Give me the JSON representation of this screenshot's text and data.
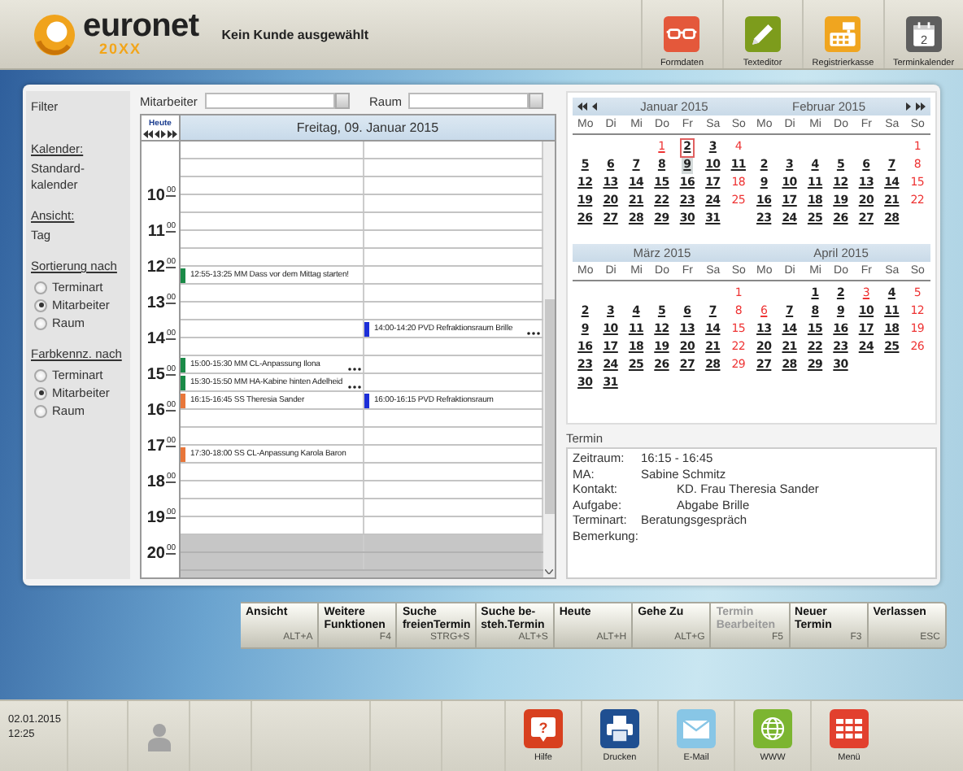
{
  "header": {
    "logo_name": "euronet",
    "logo_edition": "20XX",
    "customer": "Kein Kunde ausgewählt",
    "tools": [
      {
        "label": "Formdaten",
        "kind": "glasses"
      },
      {
        "label": "Texteditor",
        "kind": "pencil"
      },
      {
        "label": "Registrierkasse",
        "kind": "register"
      },
      {
        "label": "Terminkalender",
        "kind": "calendar",
        "badge": "2"
      }
    ]
  },
  "filter": {
    "title": "Filter",
    "sections": [
      {
        "kind": "value",
        "heading": "Kalender:",
        "value": "Standard-\nkalender"
      },
      {
        "kind": "value",
        "heading": "Ansicht:",
        "value": "Tag"
      },
      {
        "kind": "radio",
        "heading": "Sortierung nach",
        "options": [
          {
            "label": "Terminart",
            "selected": false
          },
          {
            "label": "Mitarbeiter",
            "selected": true
          },
          {
            "label": "Raum",
            "selected": false
          }
        ]
      },
      {
        "kind": "radio",
        "heading": "Farbkennz. nach",
        "options": [
          {
            "label": "Terminart",
            "selected": false
          },
          {
            "label": "Mitarbeiter",
            "selected": true
          },
          {
            "label": "Raum",
            "selected": false
          }
        ]
      }
    ]
  },
  "staff_filter": {
    "label": "Mitarbeiter"
  },
  "room_filter": {
    "label": "Raum"
  },
  "day_view": {
    "today_label": "Heute",
    "date_title": "Freitag, 09. Januar 2015",
    "hours": [
      {
        "closed": false
      },
      {
        "label": "10",
        "minutes": "00",
        "closed": false
      },
      {
        "label": "11",
        "minutes": "00",
        "closed": false
      },
      {
        "label": "12",
        "minutes": "00",
        "closed": false,
        "second_half": {
          "left": {
            "text": "12:55-13:25 MM Dass vor dem Mittag starten!",
            "color": "#1a8a47",
            "more": false
          }
        }
      },
      {
        "label": "13",
        "minutes": "00",
        "closed": false
      },
      {
        "label": "14",
        "minutes": "00",
        "closed": false,
        "first_half": {
          "right": {
            "text": "14:00-14:20 PVD Refraktionsraum Brille",
            "color": "#1c2fd8",
            "more": true
          }
        }
      },
      {
        "label": "15",
        "minutes": "00",
        "closed": false,
        "first_half": {
          "left": {
            "text": "15:00-15:30 MM CL-Anpassung Ilona",
            "color": "#1a8a47",
            "more": true
          }
        },
        "second_half": {
          "left": {
            "text": "15:30-15:50 MM HA-Kabine hinten Adelheid",
            "color": "#1a8a47",
            "more": true
          }
        }
      },
      {
        "label": "16",
        "minutes": "00",
        "closed": false,
        "first_half": {
          "left": {
            "text": "16:15-16:45 SS Theresia Sander",
            "color": "#e8763a",
            "more": false
          },
          "right": {
            "text": "16:00-16:15 PVD Refraktionsraum",
            "color": "#1c2fd8",
            "more": false
          }
        }
      },
      {
        "label": "17",
        "minutes": "00",
        "closed": false,
        "second_half": {
          "left": {
            "text": "17:30-18:00 SS CL-Anpassung Karola Baron",
            "color": "#e8763a",
            "more": false
          }
        }
      },
      {
        "label": "18",
        "minutes": "00",
        "closed": false
      },
      {
        "label": "19",
        "minutes": "00",
        "closed": false
      },
      {
        "label": "20",
        "minutes": "00",
        "closed": true
      }
    ]
  },
  "months": [
    {
      "title": "Januar 2015",
      "weekdays": [
        "Mo",
        "Di",
        "Mi",
        "Do",
        "Fr",
        "Sa",
        "So"
      ],
      "weeks": [
        [
          {
            "day": "1",
            "red": true,
            "marked": true,
            "today": false,
            "selected": false
          },
          {
            "day": "2",
            "red": false,
            "marked": true,
            "today": true,
            "selected": false
          },
          {
            "day": "3",
            "red": false,
            "marked": true,
            "today": false,
            "selected": false
          },
          {
            "day": "4",
            "red": true,
            "marked": false,
            "today": false,
            "selected": false
          }
        ],
        [
          {
            "day": "5",
            "red": false,
            "marked": true,
            "today": false,
            "selected": false
          },
          {
            "day": "6",
            "red": false,
            "marked": true,
            "today": false,
            "selected": false
          },
          {
            "day": "7",
            "red": false,
            "marked": true,
            "today": false,
            "selected": false
          },
          {
            "day": "8",
            "red": false,
            "marked": true,
            "today": false,
            "selected": false
          },
          {
            "day": "9",
            "red": false,
            "marked": true,
            "today": false,
            "selected": true
          },
          {
            "day": "10",
            "red": false,
            "marked": true,
            "today": false,
            "selected": false
          },
          {
            "day": "11",
            "red": false,
            "marked": true,
            "today": false,
            "selected": false
          }
        ],
        [
          {
            "day": "12",
            "red": false,
            "marked": true,
            "today": false,
            "selected": false
          },
          {
            "day": "13",
            "red": false,
            "marked": true,
            "today": false,
            "selected": false
          },
          {
            "day": "14",
            "red": false,
            "marked": true,
            "today": false,
            "selected": false
          },
          {
            "day": "15",
            "red": false,
            "marked": true,
            "today": false,
            "selected": false
          },
          {
            "day": "16",
            "red": false,
            "marked": true,
            "today": false,
            "selected": false
          },
          {
            "day": "17",
            "red": false,
            "marked": true,
            "today": false,
            "selected": false
          },
          {
            "day": "18",
            "red": true,
            "marked": false,
            "today": false,
            "selected": false
          }
        ],
        [
          {
            "day": "19",
            "red": false,
            "marked": true,
            "today": false,
            "selected": false
          },
          {
            "day": "20",
            "red": false,
            "marked": true,
            "today": false,
            "selected": false
          },
          {
            "day": "21",
            "red": false,
            "marked": true,
            "today": false,
            "selected": false
          },
          {
            "day": "22",
            "red": false,
            "marked": true,
            "today": false,
            "selected": false
          },
          {
            "day": "23",
            "red": false,
            "marked": true,
            "today": false,
            "selected": false
          },
          {
            "day": "24",
            "red": false,
            "marked": true,
            "today": false,
            "selected": false
          },
          {
            "day": "25",
            "red": true,
            "marked": false,
            "today": false,
            "selected": false
          }
        ],
        [
          {
            "day": "26",
            "red": false,
            "marked": true,
            "today": false,
            "selected": false
          },
          {
            "day": "27",
            "red": false,
            "marked": true,
            "today": false,
            "selected": false
          },
          {
            "day": "28",
            "red": false,
            "marked": true,
            "today": false,
            "selected": false
          },
          {
            "day": "29",
            "red": false,
            "marked": true,
            "today": false,
            "selected": false
          },
          {
            "day": "30",
            "red": false,
            "marked": true,
            "today": false,
            "selected": false
          },
          {
            "day": "31",
            "red": false,
            "marked": true,
            "today": false,
            "selected": false
          }
        ]
      ]
    },
    {
      "title": "Februar 2015",
      "weekdays": [
        "Mo",
        "Di",
        "Mi",
        "Do",
        "Fr",
        "Sa",
        "So"
      ],
      "weeks": [
        [
          {
            "day": "1",
            "red": true,
            "marked": false,
            "today": false,
            "selected": false
          }
        ],
        [
          {
            "day": "2",
            "red": false,
            "marked": true,
            "today": false,
            "selected": false
          },
          {
            "day": "3",
            "red": false,
            "marked": true,
            "today": false,
            "selected": false
          },
          {
            "day": "4",
            "red": false,
            "marked": true,
            "today": false,
            "selected": false
          },
          {
            "day": "5",
            "red": false,
            "marked": true,
            "today": false,
            "selected": false
          },
          {
            "day": "6",
            "red": false,
            "marked": true,
            "today": false,
            "selected": false
          },
          {
            "day": "7",
            "red": false,
            "marked": true,
            "today": false,
            "selected": false
          },
          {
            "day": "8",
            "red": true,
            "marked": false,
            "today": false,
            "selected": false
          }
        ],
        [
          {
            "day": "9",
            "red": false,
            "marked": true,
            "today": false,
            "selected": false
          },
          {
            "day": "10",
            "red": false,
            "marked": true,
            "today": false,
            "selected": false
          },
          {
            "day": "11",
            "red": false,
            "marked": true,
            "today": false,
            "selected": false
          },
          {
            "day": "12",
            "red": false,
            "marked": true,
            "today": false,
            "selected": false
          },
          {
            "day": "13",
            "red": false,
            "marked": true,
            "today": false,
            "selected": false
          },
          {
            "day": "14",
            "red": false,
            "marked": true,
            "today": false,
            "selected": false
          },
          {
            "day": "15",
            "red": true,
            "marked": false,
            "today": false,
            "selected": false
          }
        ],
        [
          {
            "day": "16",
            "red": false,
            "marked": true,
            "today": false,
            "selected": false
          },
          {
            "day": "17",
            "red": false,
            "marked": true,
            "today": false,
            "selected": false
          },
          {
            "day": "18",
            "red": false,
            "marked": true,
            "today": false,
            "selected": false
          },
          {
            "day": "19",
            "red": false,
            "marked": true,
            "today": false,
            "selected": false
          },
          {
            "day": "20",
            "red": false,
            "marked": true,
            "today": false,
            "selected": false
          },
          {
            "day": "21",
            "red": false,
            "marked": true,
            "today": false,
            "selected": false
          },
          {
            "day": "22",
            "red": true,
            "marked": false,
            "today": false,
            "selected": false
          }
        ],
        [
          {
            "day": "23",
            "red": false,
            "marked": true,
            "today": false,
            "selected": false
          },
          {
            "day": "24",
            "red": false,
            "marked": true,
            "today": false,
            "selected": false
          },
          {
            "day": "25",
            "red": false,
            "marked": true,
            "today": false,
            "selected": false
          },
          {
            "day": "26",
            "red": false,
            "marked": true,
            "today": false,
            "selected": false
          },
          {
            "day": "27",
            "red": false,
            "marked": true,
            "today": false,
            "selected": false
          },
          {
            "day": "28",
            "red": false,
            "marked": true,
            "today": false,
            "selected": false
          }
        ]
      ]
    },
    {
      "title": "März 2015",
      "weekdays": [
        "Mo",
        "Di",
        "Mi",
        "Do",
        "Fr",
        "Sa",
        "So"
      ],
      "weeks": [
        [
          {
            "day": "1",
            "red": true,
            "marked": false,
            "today": false,
            "selected": false
          }
        ],
        [
          {
            "day": "2",
            "red": false,
            "marked": true,
            "today": false,
            "selected": false
          },
          {
            "day": "3",
            "red": false,
            "marked": true,
            "today": false,
            "selected": false
          },
          {
            "day": "4",
            "red": false,
            "marked": true,
            "today": false,
            "selected": false
          },
          {
            "day": "5",
            "red": false,
            "marked": true,
            "today": false,
            "selected": false
          },
          {
            "day": "6",
            "red": false,
            "marked": true,
            "today": false,
            "selected": false
          },
          {
            "day": "7",
            "red": false,
            "marked": true,
            "today": false,
            "selected": false
          },
          {
            "day": "8",
            "red": true,
            "marked": false,
            "today": false,
            "selected": false
          }
        ],
        [
          {
            "day": "9",
            "red": false,
            "marked": true,
            "today": false,
            "selected": false
          },
          {
            "day": "10",
            "red": false,
            "marked": true,
            "today": false,
            "selected": false
          },
          {
            "day": "11",
            "red": false,
            "marked": true,
            "today": false,
            "selected": false
          },
          {
            "day": "12",
            "red": false,
            "marked": true,
            "today": false,
            "selected": false
          },
          {
            "day": "13",
            "red": false,
            "marked": true,
            "today": false,
            "selected": false
          },
          {
            "day": "14",
            "red": false,
            "marked": true,
            "today": false,
            "selected": false
          },
          {
            "day": "15",
            "red": true,
            "marked": false,
            "today": false,
            "selected": false
          }
        ],
        [
          {
            "day": "16",
            "red": false,
            "marked": true,
            "today": false,
            "selected": false
          },
          {
            "day": "17",
            "red": false,
            "marked": true,
            "today": false,
            "selected": false
          },
          {
            "day": "18",
            "red": false,
            "marked": true,
            "today": false,
            "selected": false
          },
          {
            "day": "19",
            "red": false,
            "marked": true,
            "today": false,
            "selected": false
          },
          {
            "day": "20",
            "red": false,
            "marked": true,
            "today": false,
            "selected": false
          },
          {
            "day": "21",
            "red": false,
            "marked": true,
            "today": false,
            "selected": false
          },
          {
            "day": "22",
            "red": true,
            "marked": false,
            "today": false,
            "selected": false
          }
        ],
        [
          {
            "day": "23",
            "red": false,
            "marked": true,
            "today": false,
            "selected": false
          },
          {
            "day": "24",
            "red": false,
            "marked": true,
            "today": false,
            "selected": false
          },
          {
            "day": "25",
            "red": false,
            "marked": true,
            "today": false,
            "selected": false
          },
          {
            "day": "26",
            "red": false,
            "marked": true,
            "today": false,
            "selected": false
          },
          {
            "day": "27",
            "red": false,
            "marked": true,
            "today": false,
            "selected": false
          },
          {
            "day": "28",
            "red": false,
            "marked": true,
            "today": false,
            "selected": false
          },
          {
            "day": "29",
            "red": true,
            "marked": false,
            "today": false,
            "selected": false
          }
        ],
        [
          {
            "day": "30",
            "red": false,
            "marked": true,
            "today": false,
            "selected": false
          },
          {
            "day": "31",
            "red": false,
            "marked": true,
            "today": false,
            "selected": false
          }
        ]
      ]
    },
    {
      "title": "April 2015",
      "weekdays": [
        "Mo",
        "Di",
        "Mi",
        "Do",
        "Fr",
        "Sa",
        "So"
      ],
      "weeks": [
        [
          {
            "day": "1",
            "red": false,
            "marked": true,
            "today": false,
            "selected": false
          },
          {
            "day": "2",
            "red": false,
            "marked": true,
            "today": false,
            "selected": false
          },
          {
            "day": "3",
            "red": true,
            "marked": true,
            "today": false,
            "selected": false
          },
          {
            "day": "4",
            "red": false,
            "marked": true,
            "today": false,
            "selected": false
          },
          {
            "day": "5",
            "red": true,
            "marked": false,
            "today": false,
            "selected": false
          }
        ],
        [
          {
            "day": "6",
            "red": true,
            "marked": true,
            "today": false,
            "selected": false
          },
          {
            "day": "7",
            "red": false,
            "marked": true,
            "today": false,
            "selected": false
          },
          {
            "day": "8",
            "red": false,
            "marked": true,
            "today": false,
            "selected": false
          },
          {
            "day": "9",
            "red": false,
            "marked": true,
            "today": false,
            "selected": false
          },
          {
            "day": "10",
            "red": false,
            "marked": true,
            "today": false,
            "selected": false
          },
          {
            "day": "11",
            "red": false,
            "marked": true,
            "today": false,
            "selected": false
          },
          {
            "day": "12",
            "red": true,
            "marked": false,
            "today": false,
            "selected": false
          }
        ],
        [
          {
            "day": "13",
            "red": false,
            "marked": true,
            "today": false,
            "selected": false
          },
          {
            "day": "14",
            "red": false,
            "marked": true,
            "today": false,
            "selected": false
          },
          {
            "day": "15",
            "red": false,
            "marked": true,
            "today": false,
            "selected": false
          },
          {
            "day": "16",
            "red": false,
            "marked": true,
            "today": false,
            "selected": false
          },
          {
            "day": "17",
            "red": false,
            "marked": true,
            "today": false,
            "selected": false
          },
          {
            "day": "18",
            "red": false,
            "marked": true,
            "today": false,
            "selected": false
          },
          {
            "day": "19",
            "red": true,
            "marked": false,
            "today": false,
            "selected": false
          }
        ],
        [
          {
            "day": "20",
            "red": false,
            "marked": true,
            "today": false,
            "selected": false
          },
          {
            "day": "21",
            "red": false,
            "marked": true,
            "today": false,
            "selected": false
          },
          {
            "day": "22",
            "red": false,
            "marked": true,
            "today": false,
            "selected": false
          },
          {
            "day": "23",
            "red": false,
            "marked": true,
            "today": false,
            "selected": false
          },
          {
            "day": "24",
            "red": false,
            "marked": true,
            "today": false,
            "selected": false
          },
          {
            "day": "25",
            "red": false,
            "marked": true,
            "today": false,
            "selected": false
          },
          {
            "day": "26",
            "red": true,
            "marked": false,
            "today": false,
            "selected": false
          }
        ],
        [
          {
            "day": "27",
            "red": false,
            "marked": true,
            "today": false,
            "selected": false
          },
          {
            "day": "28",
            "red": false,
            "marked": true,
            "today": false,
            "selected": false
          },
          {
            "day": "29",
            "red": false,
            "marked": true,
            "today": false,
            "selected": false
          },
          {
            "day": "30",
            "red": false,
            "marked": true,
            "today": false,
            "selected": false
          }
        ]
      ]
    }
  ],
  "appointment": {
    "title": "Termin",
    "fields": [
      {
        "label": "Zeitraum:",
        "value": "16:15 - 16:45",
        "kind": "plain"
      },
      {
        "label": "MA:",
        "value": "Sabine Schmitz",
        "kind": "plain"
      },
      {
        "label": "Kontakt:",
        "value": "KD. Frau Theresia Sander",
        "kind": "indented"
      },
      {
        "label": "Aufgabe:",
        "value": "Abgabe Brille",
        "kind": "indented"
      },
      {
        "label": "Terminart:",
        "value": "Beratungsgespräch",
        "kind": "plain"
      },
      {
        "label": "Bemerkung:"
      }
    ]
  },
  "commands": [
    {
      "label": "Ansicht",
      "shortcut": "ALT+A",
      "disabled": false
    },
    {
      "label": "Weitere\nFunktionen",
      "shortcut": "F4",
      "disabled": false
    },
    {
      "label": "Suche\nfreienTermin",
      "shortcut": "STRG+S",
      "disabled": false
    },
    {
      "label": "Suche be-\nsteh.Termin",
      "shortcut": "ALT+S",
      "disabled": false
    },
    {
      "label": "Heute",
      "shortcut": "ALT+H",
      "disabled": false
    },
    {
      "label": "Gehe Zu",
      "shortcut": "ALT+G",
      "disabled": false
    },
    {
      "label": "Termin\nBearbeiten",
      "shortcut": "F5",
      "disabled": true
    },
    {
      "label": "Neuer\nTermin",
      "shortcut": "F3",
      "disabled": false
    },
    {
      "label": "Verlassen",
      "shortcut": "ESC",
      "disabled": false
    }
  ],
  "status_bar": {
    "date": "02.01.2015",
    "time": "12:25",
    "apps": [
      {
        "label": "Hilfe",
        "kind": "help",
        "symbol": "?"
      },
      {
        "label": "Drucken",
        "kind": "print"
      },
      {
        "label": "E-Mail",
        "kind": "mail"
      },
      {
        "label": "WWW",
        "kind": "web"
      },
      {
        "label": "Menü",
        "kind": "menu"
      }
    ]
  }
}
